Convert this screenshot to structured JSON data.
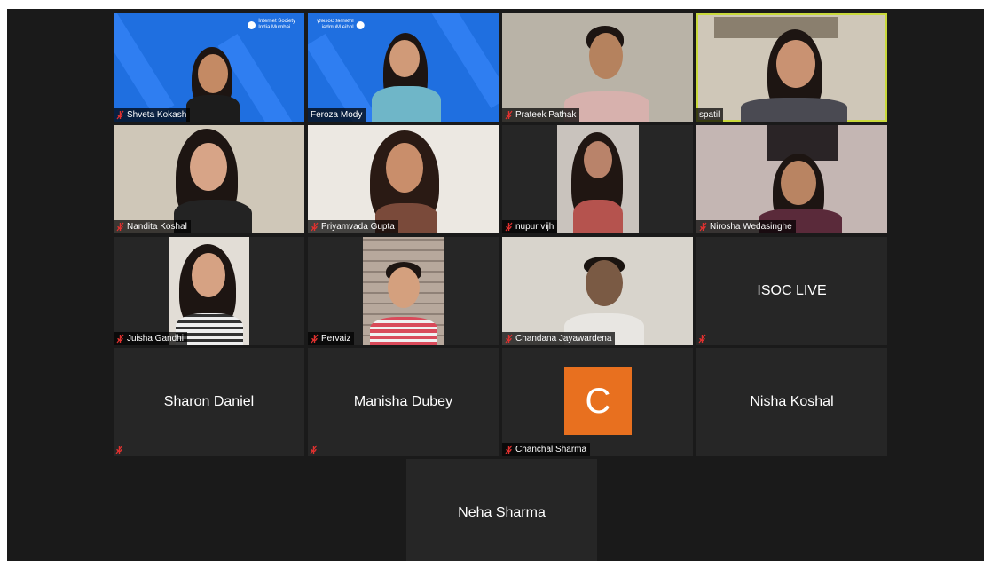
{
  "tiles": [
    {
      "id": "shveta",
      "name": "Shveta Kokash",
      "muted": true
    },
    {
      "id": "feroza",
      "name": "Feroza Mody",
      "muted": false
    },
    {
      "id": "prateek",
      "name": "Prateek Pathak",
      "muted": true
    },
    {
      "id": "spatil",
      "name": "spatil",
      "muted": false,
      "active_speaker": true
    },
    {
      "id": "nandita",
      "name": "Nandita Koshal",
      "muted": true
    },
    {
      "id": "priyamvada",
      "name": "Priyamvada Gupta",
      "muted": true
    },
    {
      "id": "nupur",
      "name": "nupur vijh",
      "muted": true
    },
    {
      "id": "nirosha",
      "name": "Nirosha Wedasinghe",
      "muted": true
    },
    {
      "id": "juisha",
      "name": "Juisha Gandhi",
      "muted": true
    },
    {
      "id": "pervaiz",
      "name": "Pervaiz",
      "muted": true
    },
    {
      "id": "chandana",
      "name": "Chandana Jayawardena",
      "muted": true
    },
    {
      "id": "isoc",
      "name": "ISOC LIVE",
      "muted": true
    },
    {
      "id": "sharon",
      "name": "Sharon Daniel",
      "muted": true
    },
    {
      "id": "manisha",
      "name": "Manisha Dubey",
      "muted": true
    },
    {
      "id": "chanchal",
      "name": "Chanchal Sharma",
      "muted": true,
      "avatar_letter": "C"
    },
    {
      "id": "nisha",
      "name": "Nisha Koshal",
      "muted": false
    },
    {
      "id": "neha",
      "name": "Neha Sharma",
      "muted": false
    }
  ],
  "logo": {
    "line1": "Internet Society",
    "line2": "India Mumbai"
  },
  "colors": {
    "background": "#1a1a1a",
    "tile": "#262626",
    "active_border": "#c9d93b",
    "muted_icon": "#e0312f",
    "avatar": "#e8701f",
    "virtual_bg": "#1f6fe0"
  }
}
